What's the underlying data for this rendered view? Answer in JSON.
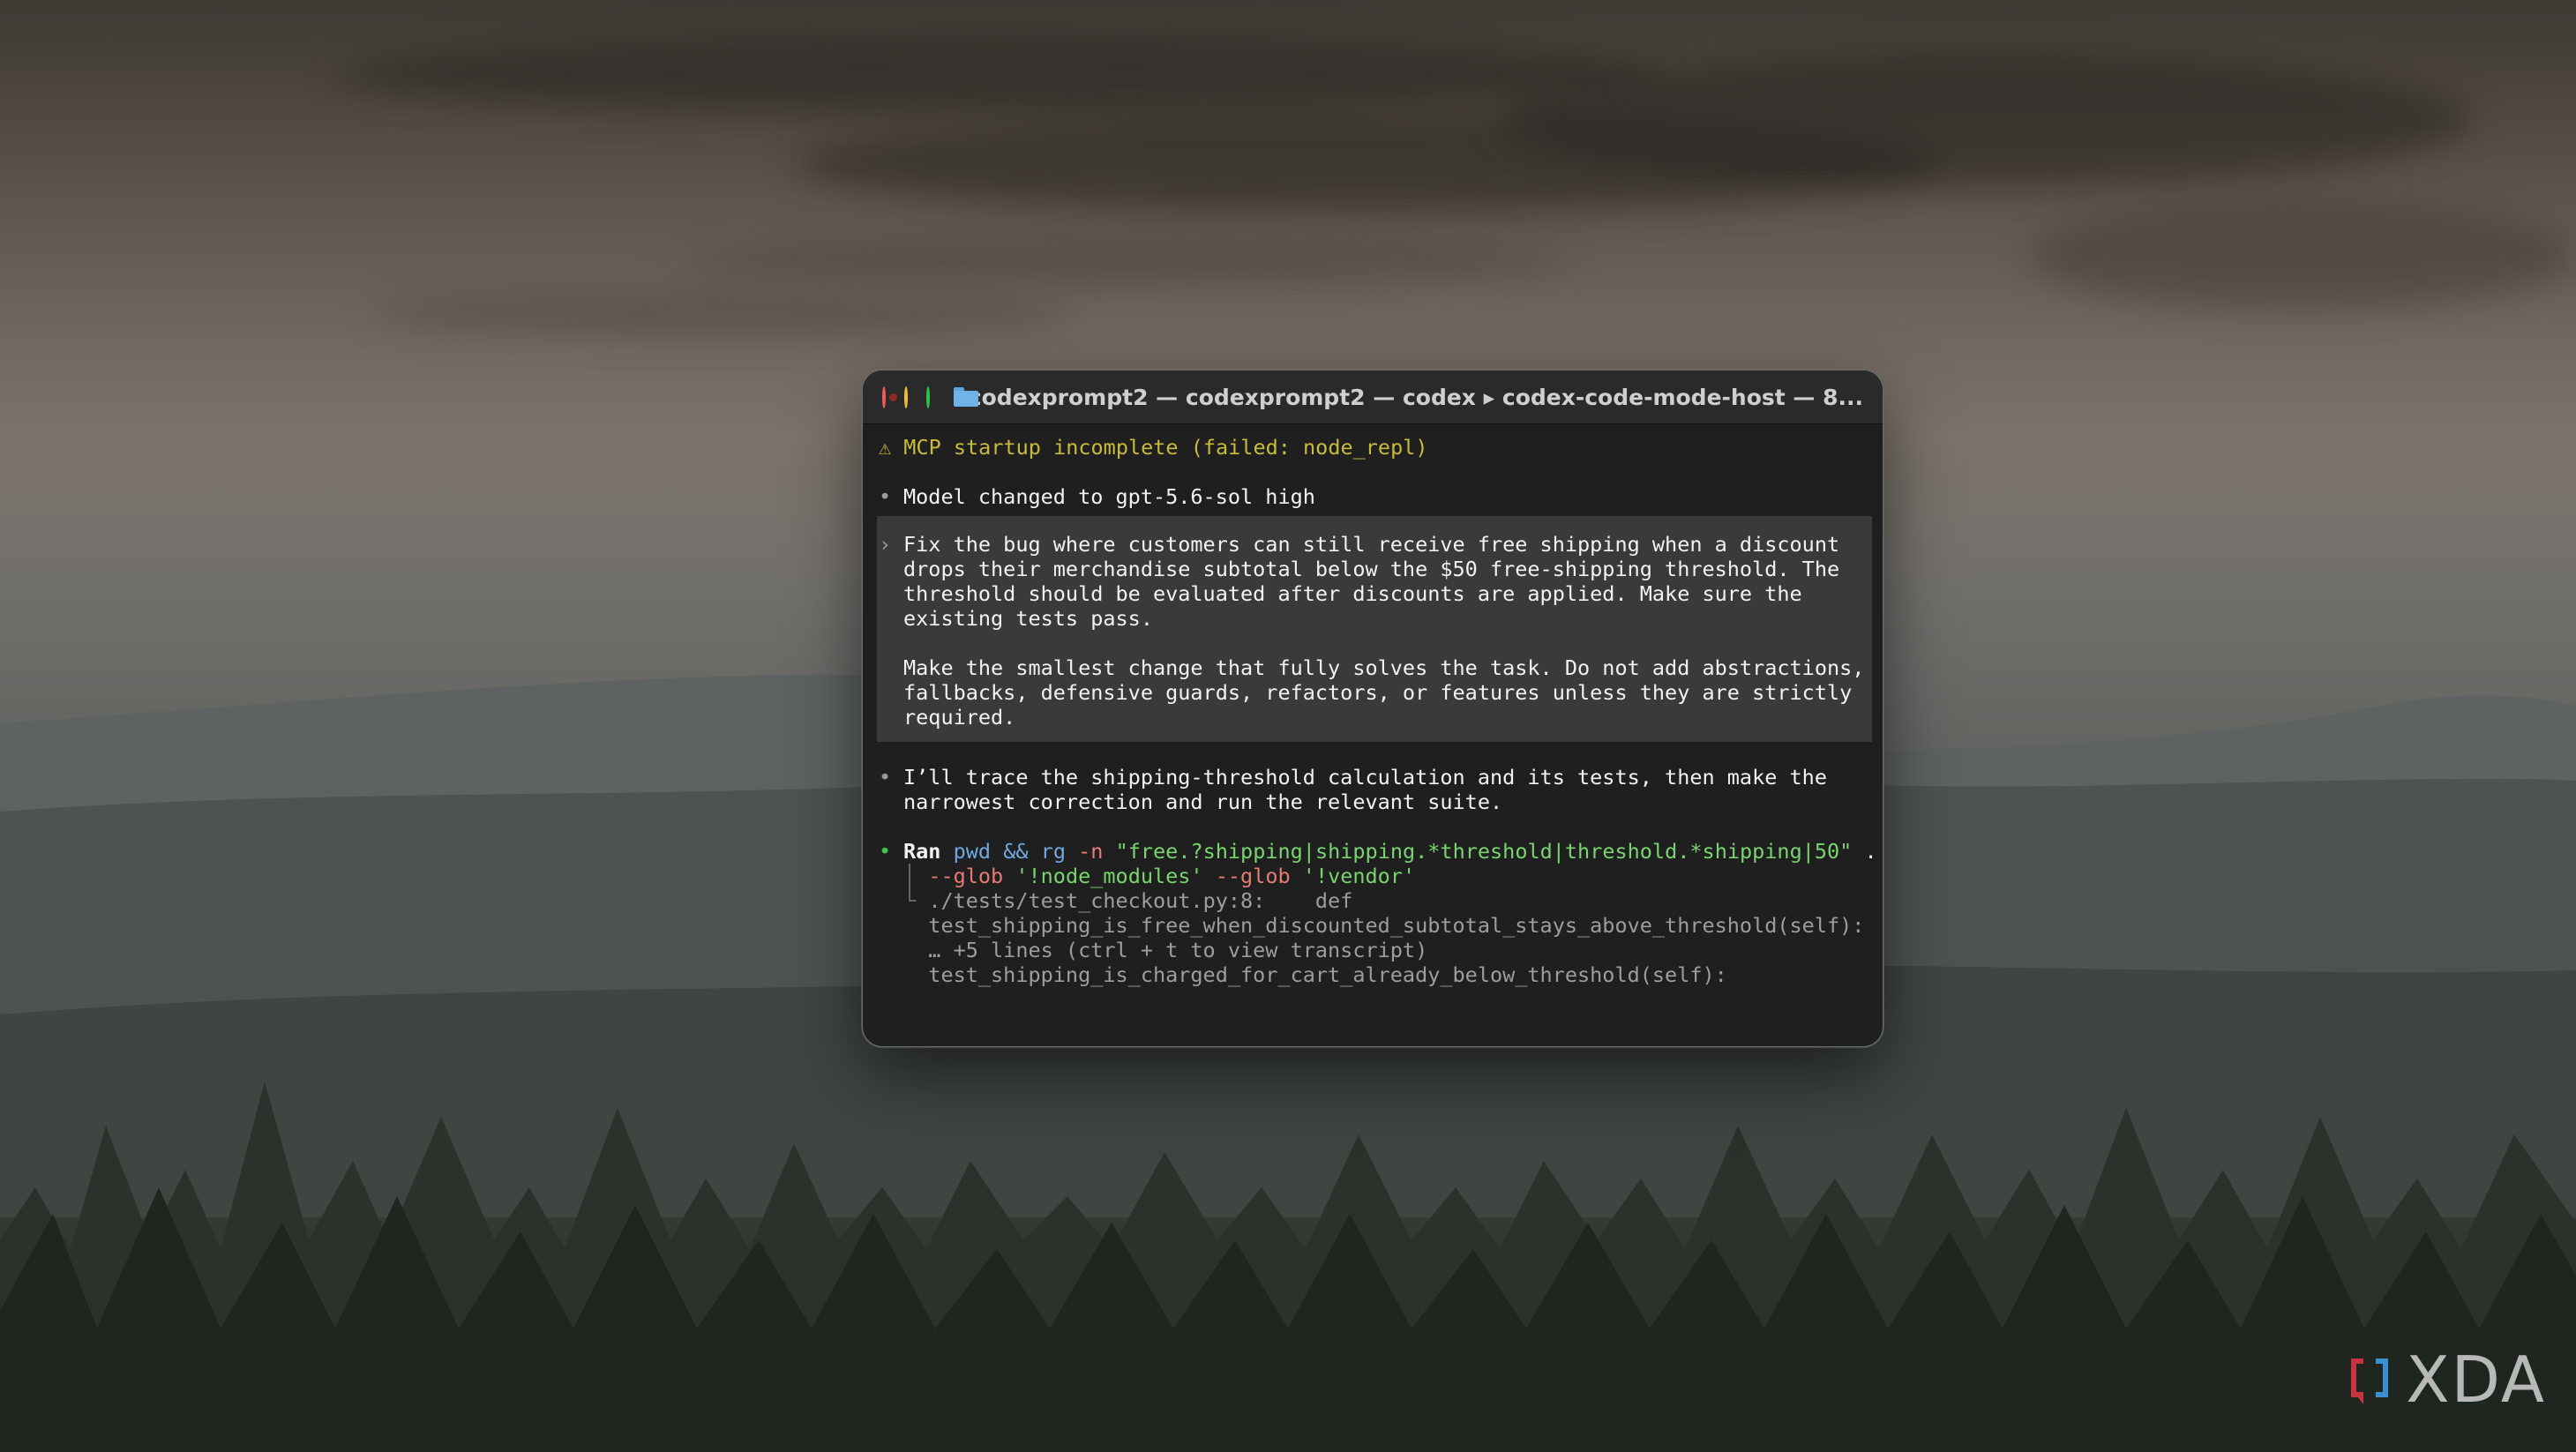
{
  "window": {
    "title": "codexprompt2 — codexprompt2 — codex ▸ codex-code-mode-host — 8..."
  },
  "terminal": {
    "warning": "⚠ MCP startup incomplete (failed: node_repl)",
    "bullet": "•",
    "model_changed": "Model changed to gpt-5.6-sol high",
    "prompt_marker": "›",
    "prompt_lines": [
      "Fix the bug where customers can still receive free shipping when a discount",
      "drops their merchandise subtotal below the $50 free-shipping threshold. The",
      "threshold should be evaluated after discounts are applied. Make sure the",
      "existing tests pass.",
      "",
      "Make the smallest change that fully solves the task. Do not add abstractions,",
      "fallbacks, defensive guards, refactors, or features unless they are strictly",
      "required."
    ],
    "assistant_lines": [
      "I’ll trace the shipping-threshold calculation and its tests, then make the",
      "narrowest correction and run the relevant suite."
    ],
    "ran": {
      "label": "Ran",
      "cmd1": "pwd",
      "op": "&&",
      "cmd2": "rg",
      "flag_n": "-n",
      "pattern": "\"free.?shipping|shipping.*threshold|threshold.*shipping|50\"",
      "dot": ".",
      "glob1": "--glob",
      "glob1_val": "'!node_modules'",
      "glob2": "--glob",
      "glob2_val": "'!vendor'",
      "tree_mid": "│",
      "tree_end": "└",
      "output": [
        "./tests/test_checkout.py:8:    def",
        "test_shipping_is_free_when_discounted_subtotal_stays_above_threshold(self):",
        "… +5 lines (ctrl + t to view transcript)",
        "test_shipping_is_charged_for_cart_already_below_threshold(self):"
      ]
    }
  },
  "watermark": {
    "text": "XDA"
  },
  "colors": {
    "warning": "#c9bb3b",
    "success_dot": "#38c550",
    "command": "#6ea8e0",
    "string": "#79d46f",
    "option": "#e67a74"
  }
}
